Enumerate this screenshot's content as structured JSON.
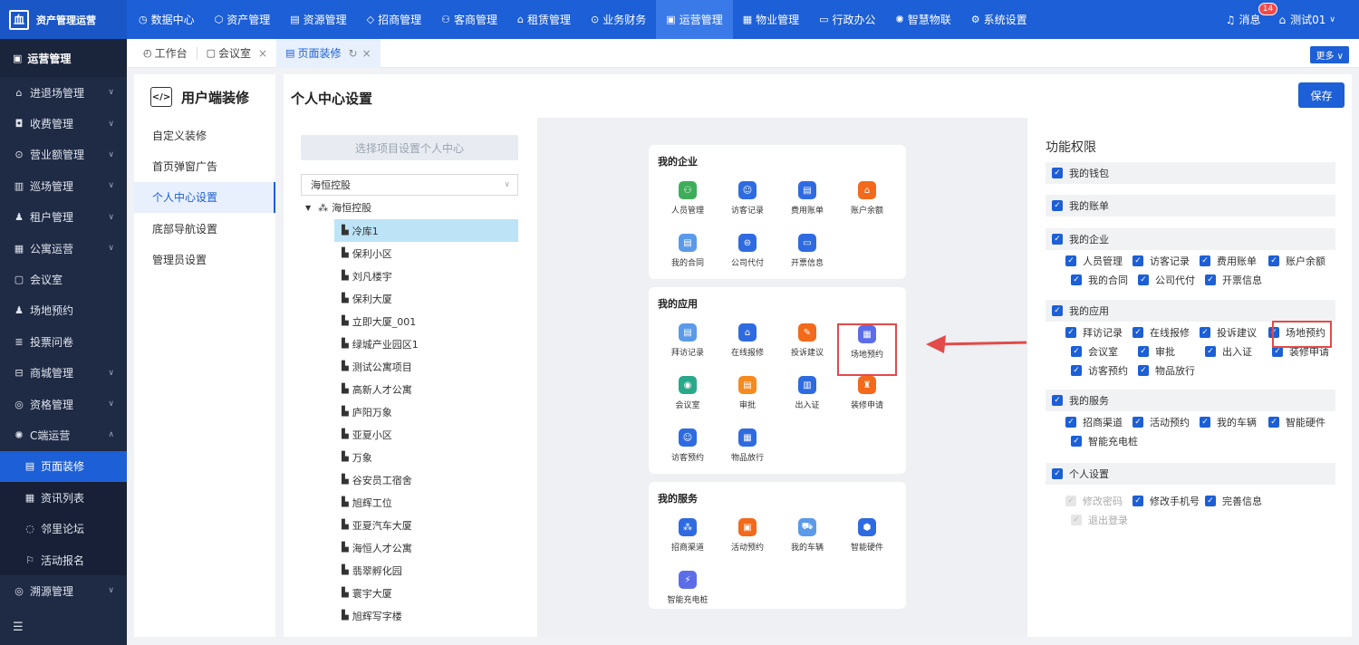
{
  "brand": {
    "title": "资产管理运营",
    "logo_glyph": "血"
  },
  "top_nav": [
    {
      "label": "数据中心",
      "icon": "clock-icon"
    },
    {
      "label": "资产管理",
      "icon": "cube-icon"
    },
    {
      "label": "资源管理",
      "icon": "doc-icon"
    },
    {
      "label": "招商管理",
      "icon": "tag-icon"
    },
    {
      "label": "客商管理",
      "icon": "users-icon"
    },
    {
      "label": "租赁管理",
      "icon": "home-icon"
    },
    {
      "label": "业务财务",
      "icon": "coin-icon"
    },
    {
      "label": "运营管理",
      "icon": "chart-icon",
      "active": true
    },
    {
      "label": "物业管理",
      "icon": "building-icon"
    },
    {
      "label": "行政办公",
      "icon": "monitor-icon"
    },
    {
      "label": "智慧物联",
      "icon": "gear-icon"
    },
    {
      "label": "系统设置",
      "icon": "settings-icon"
    }
  ],
  "top_right": {
    "messages_label": "消息",
    "messages_count": "14",
    "user_label": "测试01"
  },
  "sidebar": {
    "header": "运营管理",
    "items": [
      {
        "label": "进退场管理",
        "icon": "home-icon",
        "arrow": "down"
      },
      {
        "label": "收费管理",
        "icon": "wallet-icon",
        "arrow": "down"
      },
      {
        "label": "营业额管理",
        "icon": "coin-icon",
        "arrow": "down"
      },
      {
        "label": "巡场管理",
        "icon": "map-icon",
        "arrow": "down"
      },
      {
        "label": "租户管理",
        "icon": "user-icon",
        "arrow": "down"
      },
      {
        "label": "公寓运营",
        "icon": "building-icon",
        "arrow": "down"
      },
      {
        "label": "会议室",
        "icon": "meeting-icon",
        "arrow": ""
      },
      {
        "label": "场地预约",
        "icon": "user-icon",
        "arrow": ""
      },
      {
        "label": "投票问卷",
        "icon": "list-icon",
        "arrow": ""
      },
      {
        "label": "商城管理",
        "icon": "shop-icon",
        "arrow": "down"
      },
      {
        "label": "资格管理",
        "icon": "badge-icon",
        "arrow": "down"
      },
      {
        "label": "C端运营",
        "icon": "gear-icon",
        "arrow": "up"
      }
    ],
    "sub_items": [
      {
        "label": "页面装修",
        "icon": "page-icon",
        "active": true
      },
      {
        "label": "资讯列表",
        "icon": "news-icon"
      },
      {
        "label": "邻里论坛",
        "icon": "chat-icon"
      },
      {
        "label": "活动报名",
        "icon": "flag-icon"
      }
    ],
    "last_item": {
      "label": "溯源管理",
      "icon": "target-icon",
      "arrow": "down"
    }
  },
  "tabs": [
    {
      "label": "工作台",
      "icon": "dashboard-icon",
      "closable": false
    },
    {
      "label": "会议室",
      "icon": "meeting-icon",
      "closable": true
    },
    {
      "label": "页面装修",
      "icon": "page-icon",
      "closable": true,
      "active": true
    }
  ],
  "more_label": "更多",
  "menu": {
    "title": "用户端装修",
    "items": [
      {
        "label": "自定义装修"
      },
      {
        "label": "首页弹窗广告"
      },
      {
        "label": "个人中心设置",
        "active": true
      },
      {
        "label": "底部导航设置"
      },
      {
        "label": "管理员设置"
      }
    ]
  },
  "main": {
    "title": "个人中心设置",
    "save_label": "保存"
  },
  "project": {
    "select_button": "选择项目设置个人中心",
    "selected_value": "海恒控股",
    "tree_root": "海恒控股",
    "tree_items": [
      "冷库1",
      "保利小区",
      "刘凡楼宇",
      "保利大厦",
      "立即大厦_001",
      "绿城产业园区1",
      "测试公寓项目",
      "高新人才公寓",
      "庐阳万象",
      "亚夏小区",
      "万象",
      "谷安员工宿舍",
      "旭辉工位",
      "亚夏汽车大厦",
      "海恒人才公寓",
      "翡翠孵化园",
      "寰宇大厦",
      "旭辉写字楼"
    ],
    "selected_item": "冷库1"
  },
  "phone": {
    "cards": [
      {
        "title": "我的企业",
        "apps": [
          {
            "label": "人员管理",
            "color": "#3fae5a",
            "glyph": "⚇"
          },
          {
            "label": "访客记录",
            "color": "#2f6be0",
            "glyph": "☺"
          },
          {
            "label": "费用账单",
            "color": "#2f6be0",
            "glyph": "▤"
          },
          {
            "label": "账户余额",
            "color": "#f26a1b",
            "glyph": "⌂"
          },
          {
            "label": "我的合同",
            "color": "#5b9ae8",
            "glyph": "▤"
          },
          {
            "label": "公司代付",
            "color": "#2f6be0",
            "glyph": "⊜"
          },
          {
            "label": "开票信息",
            "color": "#2f6be0",
            "glyph": "▭"
          }
        ]
      },
      {
        "title": "我的应用",
        "apps": [
          {
            "label": "拜访记录",
            "color": "#5b9ae8",
            "glyph": "▤"
          },
          {
            "label": "在线报修",
            "color": "#2f6be0",
            "glyph": "⌂"
          },
          {
            "label": "投诉建议",
            "color": "#f26a1b",
            "glyph": "✎"
          },
          {
            "label": "场地预约",
            "color": "#5b6ee8",
            "glyph": "▦",
            "highlight": true
          },
          {
            "label": "会议室",
            "color": "#2aa88a",
            "glyph": "◉"
          },
          {
            "label": "审批",
            "color": "#f58a1f",
            "glyph": "▤"
          },
          {
            "label": "出入证",
            "color": "#2f6be0",
            "glyph": "▥"
          },
          {
            "label": "装修申请",
            "color": "#f26a1b",
            "glyph": "♜"
          },
          {
            "label": "访客预约",
            "color": "#2f6be0",
            "glyph": "☺"
          },
          {
            "label": "物品放行",
            "color": "#2f6be0",
            "glyph": "▦"
          }
        ]
      },
      {
        "title": "我的服务",
        "apps": [
          {
            "label": "招商渠道",
            "color": "#2f6be0",
            "glyph": "⁂"
          },
          {
            "label": "活动预约",
            "color": "#f26a1b",
            "glyph": "▣"
          },
          {
            "label": "我的车辆",
            "color": "#5b9ae8",
            "glyph": "⛟"
          },
          {
            "label": "智能硬件",
            "color": "#2f6be0",
            "glyph": "⬢"
          },
          {
            "label": "智能充电桩",
            "color": "#5b6ee8",
            "glyph": "⚡"
          }
        ]
      }
    ]
  },
  "permissions": {
    "title": "功能权限",
    "sections": [
      {
        "label": "我的钱包",
        "options": []
      },
      {
        "label": "我的账单",
        "options": []
      },
      {
        "label": "我的企业",
        "options": [
          [
            "人员管理",
            "访客记录",
            "费用账单",
            "账户余额"
          ],
          [
            "我的合同",
            "公司代付",
            "开票信息"
          ]
        ]
      },
      {
        "label": "我的应用",
        "options": [
          [
            "拜访记录",
            "在线报修",
            "投诉建议",
            "场地预约"
          ],
          [
            "会议室",
            "审批",
            "出入证",
            "装修申请"
          ],
          [
            "访客预约",
            "物品放行"
          ]
        ]
      },
      {
        "label": "我的服务",
        "options": [
          [
            "招商渠道",
            "活动预约",
            "我的车辆",
            "智能硬件"
          ],
          [
            "智能充电桩"
          ]
        ]
      },
      {
        "label": "个人设置",
        "options": []
      }
    ],
    "personal_options": [
      {
        "label": "修改密码",
        "disabled": true
      },
      {
        "label": "修改手机号",
        "disabled": false
      },
      {
        "label": "完善信息",
        "disabled": false
      },
      {
        "label": "退出登录",
        "disabled": true
      }
    ]
  },
  "colors": {
    "primary": "#1c5fd6",
    "sidebar": "#1f2a44",
    "highlight": "#e34a4a"
  }
}
